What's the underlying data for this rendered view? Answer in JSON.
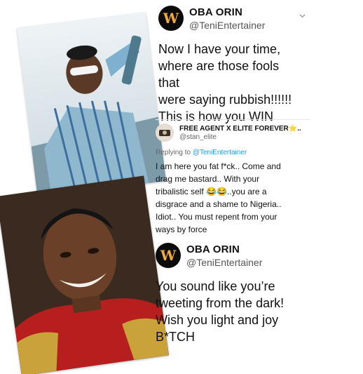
{
  "tweet1": {
    "name": "OBA ORIN",
    "handle": "@TeniEntertainer",
    "text_lines": [
      "Now I have your time,",
      "where are those fools that",
      "were saying rubbish!!!!!!",
      "This is how you WIN"
    ]
  },
  "tweet2": {
    "name": "FREE AGENT X ELITE FOREVER⭐️..",
    "handle": "@stan_elite",
    "replying_prefix": "Replying to ",
    "replying_mention": "@TeniEntertainer",
    "text_lines": [
      "I am here you fat f*ck.. Come and",
      "drag me bastard.. With your",
      "tribalistic self 😂😂..you are a",
      "disgrace and a shame to Nigeria..",
      "Idiot.. You must repent from your",
      "ways by force"
    ]
  },
  "tweet3": {
    "name": "OBA ORIN",
    "handle": "@TeniEntertainer",
    "text_lines": [
      "You sound like you’re",
      "tweeting from the dark!",
      "Wish you light and joy",
      "B*TCH"
    ]
  },
  "colors": {
    "mention": "#1d9bf0",
    "handle": "#555555",
    "avatar_bg": "#0b0b0b",
    "avatar_letter": "#f2a93b"
  },
  "icons": {
    "avatar_letter": "W",
    "chevron": "chevron-down-icon"
  }
}
